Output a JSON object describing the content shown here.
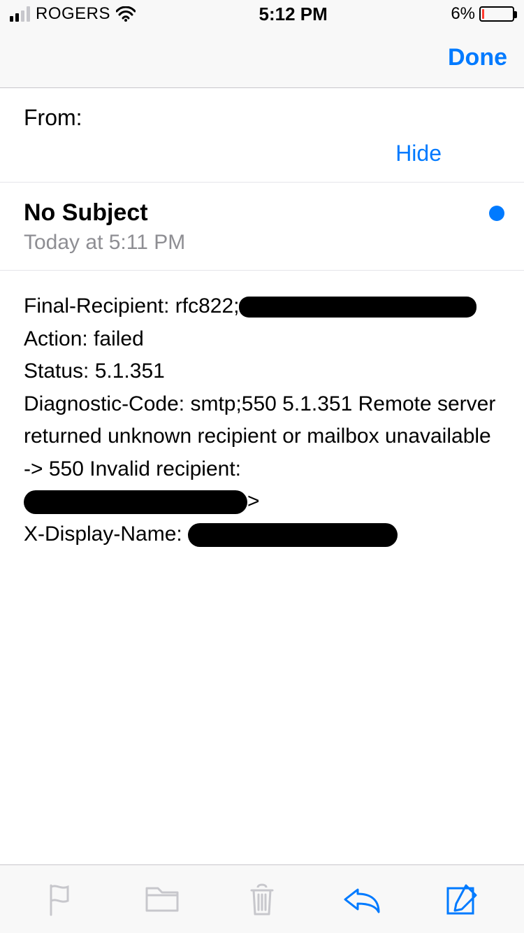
{
  "status": {
    "carrier": "ROGERS",
    "time": "5:12 PM",
    "battery_pct": "6%",
    "signal_active_bars": 2,
    "signal_total_bars": 4
  },
  "nav": {
    "done_label": "Done"
  },
  "mail": {
    "from_label": "From:",
    "hide_label": "Hide",
    "subject": "No Subject",
    "date": "Today at 5:11 PM",
    "body": {
      "line1_prefix": "Final-Recipient: rfc822;",
      "line2": "Action: failed",
      "line3": "Status: 5.1.351",
      "line4": "Diagnostic-Code: smtp;550 5.1.351 Remote server returned unknown recipient or mailbox unavailable -> 550 Invalid recipient:",
      "line5_caret": ">",
      "line6_prefix": "X-Display-Name:"
    }
  },
  "colors": {
    "accent": "#007aff",
    "muted_icon": "#c7c7cc",
    "battery_low": "#ff3b30"
  }
}
